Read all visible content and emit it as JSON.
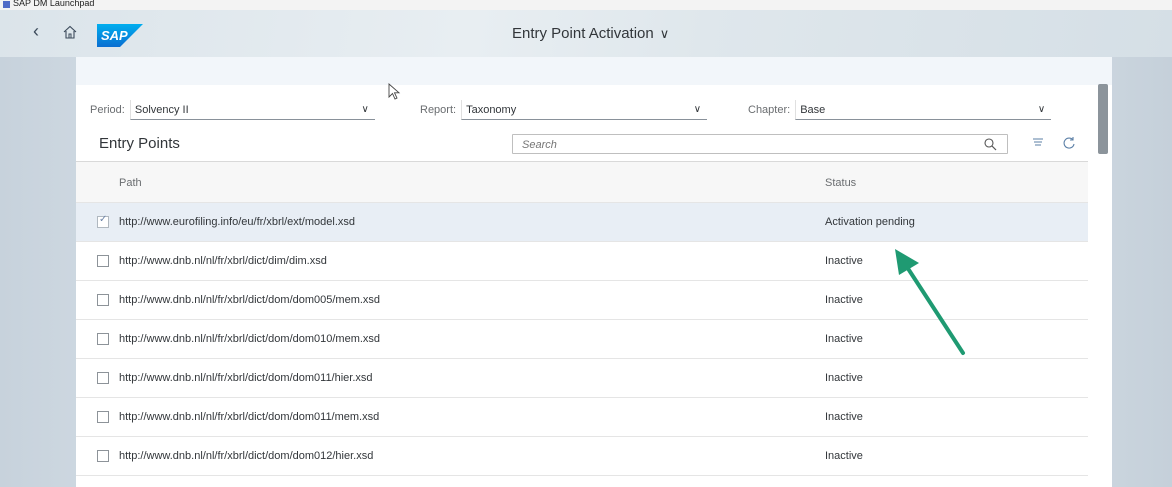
{
  "window": {
    "title": "SAP DM Launchpad"
  },
  "shell": {
    "title": "Entry Point Activation",
    "logo_text": "SAP"
  },
  "filters": {
    "period": {
      "label": "Period:",
      "value": "Solvency II"
    },
    "report": {
      "label": "Report:",
      "value": "Taxonomy"
    },
    "chapter": {
      "label": "Chapter:",
      "value": "Base"
    }
  },
  "table": {
    "title": "Entry Points",
    "search_placeholder": "Search",
    "columns": {
      "path": "Path",
      "status": "Status"
    },
    "rows": [
      {
        "path": "http://www.eurofiling.info/eu/fr/xbrl/ext/model.xsd",
        "status": "Activation pending",
        "selected": true
      },
      {
        "path": "http://www.dnb.nl/nl/fr/xbrl/dict/dim/dim.xsd",
        "status": "Inactive",
        "selected": false
      },
      {
        "path": "http://www.dnb.nl/nl/fr/xbrl/dict/dom/dom005/mem.xsd",
        "status": "Inactive",
        "selected": false
      },
      {
        "path": "http://www.dnb.nl/nl/fr/xbrl/dict/dom/dom010/mem.xsd",
        "status": "Inactive",
        "selected": false
      },
      {
        "path": "http://www.dnb.nl/nl/fr/xbrl/dict/dom/dom011/hier.xsd",
        "status": "Inactive",
        "selected": false
      },
      {
        "path": "http://www.dnb.nl/nl/fr/xbrl/dict/dom/dom011/mem.xsd",
        "status": "Inactive",
        "selected": false
      },
      {
        "path": "http://www.dnb.nl/nl/fr/xbrl/dict/dom/dom012/hier.xsd",
        "status": "Inactive",
        "selected": false
      }
    ]
  },
  "colors": {
    "brand": "#0a6ed1",
    "annotation_arrow": "#1f9a72",
    "selected_row": "#e8eef5"
  },
  "icons": [
    "back-icon",
    "home-icon",
    "chevron-down-icon",
    "search-icon",
    "sort-icon",
    "refresh-icon",
    "checkbox-icon"
  ]
}
